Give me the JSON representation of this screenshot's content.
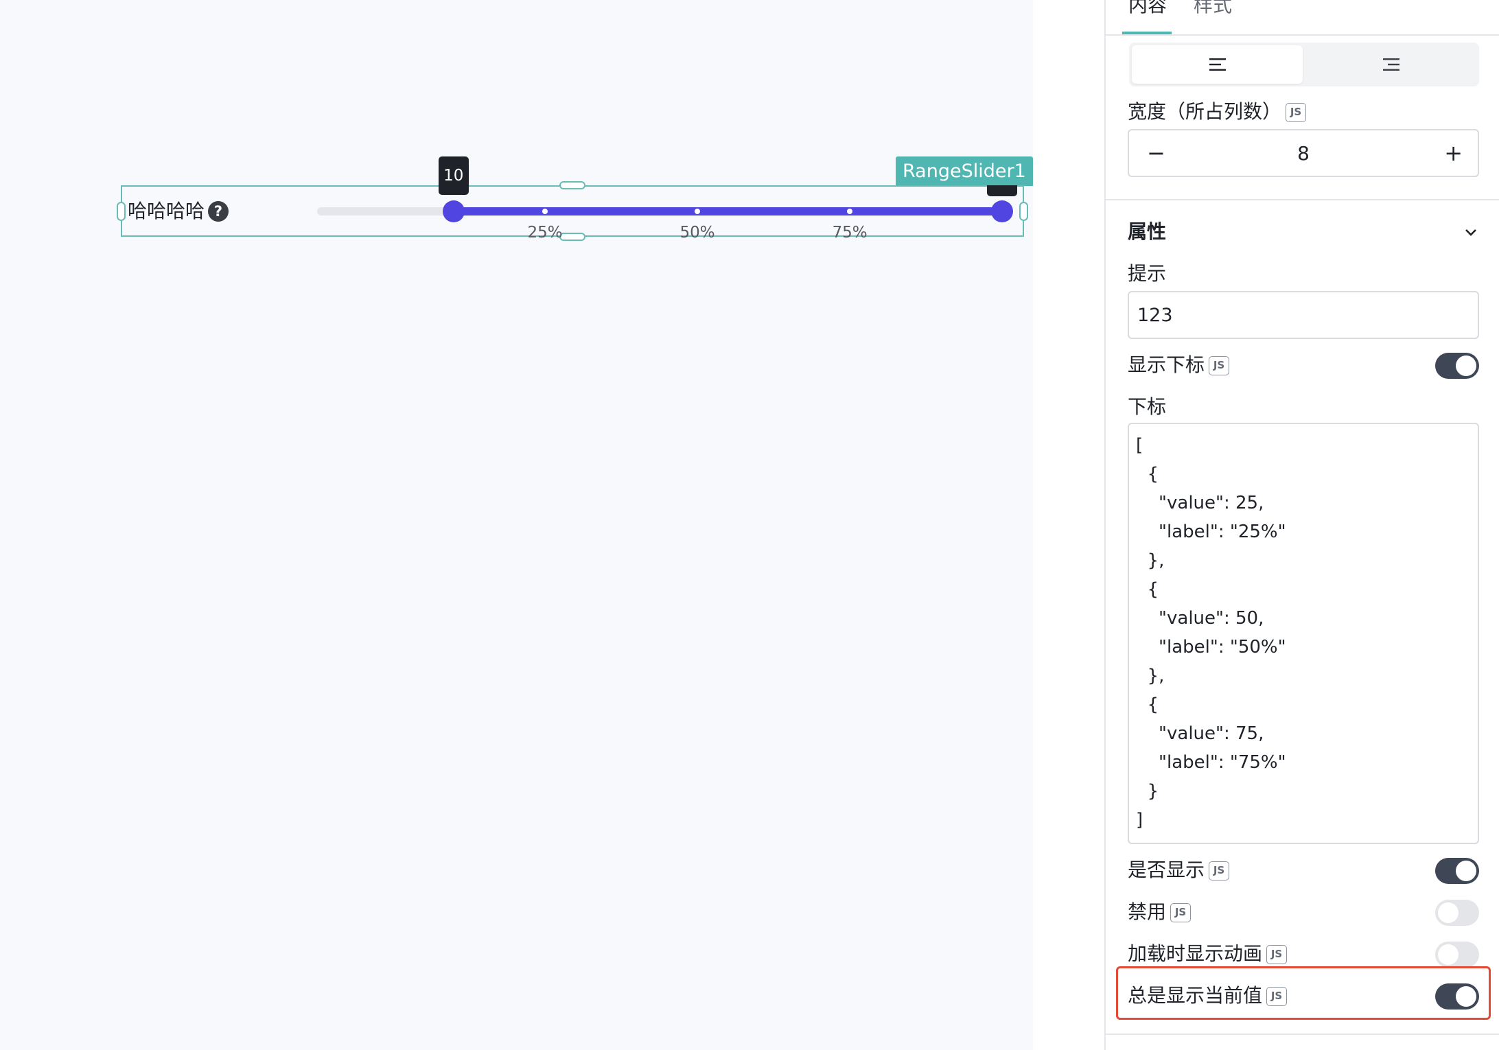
{
  "canvas": {
    "component_tag": "RangeSlider1",
    "slider": {
      "label": "哈哈哈哈",
      "help_icon": "question-circle-icon",
      "min": 0,
      "max": 100,
      "value_start": 10,
      "value_end": 100,
      "tooltip_start": "10",
      "marks": [
        {
          "value": 25,
          "label": "25%"
        },
        {
          "value": 50,
          "label": "50%"
        },
        {
          "value": 75,
          "label": "75%"
        }
      ],
      "track_color": "#5045e0",
      "selection_color": "#67bcb6"
    }
  },
  "panel": {
    "tabs": [
      {
        "label": "内容",
        "active": true
      },
      {
        "label": "样式",
        "active": false
      }
    ],
    "align": {
      "options": [
        "align-left-icon",
        "align-right-icon"
      ],
      "selected": 0
    },
    "width": {
      "label": "宽度（所占列数）",
      "value": "8",
      "minus": "−",
      "plus": "+"
    },
    "section": {
      "title": "属性",
      "chevron": "chevron-down-icon"
    },
    "hint": {
      "label": "提示",
      "value": "123"
    },
    "show_marks": {
      "label": "显示下标",
      "on": true
    },
    "marks": {
      "label": "下标",
      "code_lines": [
        "[",
        "  {",
        "    \"value\": 25,",
        "    \"label\": \"25%\"",
        "  },",
        "  {",
        "    \"value\": 50,",
        "    \"label\": \"50%\"",
        "  },",
        "  {",
        "    \"value\": 75,",
        "    \"label\": \"75%\"",
        "  }",
        "]"
      ]
    },
    "visible": {
      "label": "是否显示",
      "on": true
    },
    "disabled": {
      "label": "禁用",
      "on": false
    },
    "loading": {
      "label": "加载时显示动画",
      "on": false
    },
    "always_show": {
      "label": "总是显示当前值",
      "on": true
    },
    "js_badge": "JS",
    "highlight_color": "#e24a36"
  }
}
